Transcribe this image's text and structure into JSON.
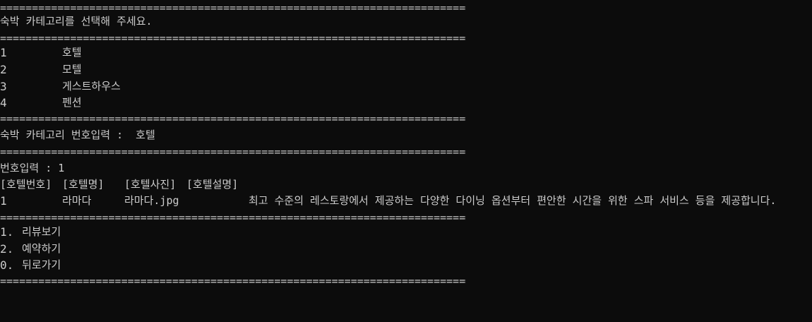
{
  "separator": "=====================================================================================",
  "prompt_category": "숙박 카테고리를 선택해 주세요.",
  "categories": [
    {
      "num": "1",
      "label": "호텔"
    },
    {
      "num": "2",
      "label": "모텔"
    },
    {
      "num": "3",
      "label": "게스트하우스"
    },
    {
      "num": "4",
      "label": "펜션"
    }
  ],
  "category_input": "숙박 카테고리 번호입력 :  호텔",
  "number_input": "번호입력 : 1",
  "table": {
    "headers": [
      "[호텔번호]",
      "[호텔명]",
      "[호텔사진]",
      "[호텔설명]"
    ],
    "row": {
      "no": "1",
      "name": "라마다",
      "photo": "라마다.jpg",
      "desc": "최고 수준의 레스토랑에서 제공하는 다양한 다이닝 옵션부터 편안한 시간을 위한 스파 서비스 등을 제공합니다."
    }
  },
  "menu": [
    {
      "num": "1.",
      "label": "리뷰보기"
    },
    {
      "num": "2.",
      "label": "예약하기"
    },
    {
      "num": "0.",
      "label": "뒤로가기"
    }
  ]
}
